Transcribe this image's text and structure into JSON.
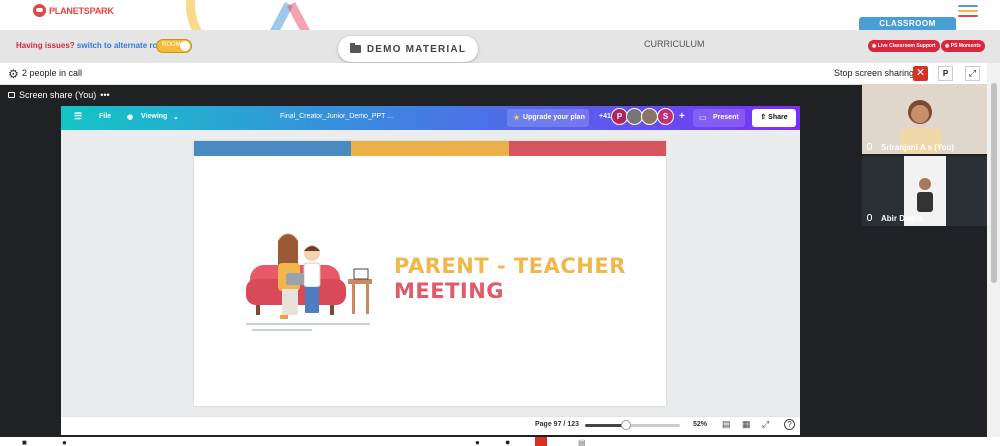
{
  "app": {
    "brand": "PLANETSPARK",
    "issue_text": "Having issues?",
    "issue_link": "switch to alternate room",
    "toggle_label": "ROOM",
    "demo_material": "DEMO MATERIAL",
    "curriculum": "CURRICULUM",
    "classroom": "CLASSROOM",
    "support_button": "Live Classroom Support",
    "moments_button": "PS Moments"
  },
  "call": {
    "people_label": "2 people in call",
    "stop_sharing": "Stop screen sharing",
    "close_icon": "close-icon",
    "presenter_initial": "P",
    "screen_share_label": "Screen share (You)",
    "more_label": "•••"
  },
  "canva": {
    "file": "File",
    "viewing": "Viewing",
    "doc_title": "Final_Creator_Junior_Demo_PPT ...",
    "upgrade": "Upgrade your plan",
    "collab_count": "+41",
    "avatar_p": "P",
    "avatar_s": "S",
    "plus": "+",
    "present": "Present",
    "share": "Share",
    "page_indicator": "Page 97 / 123",
    "zoom": "52%",
    "zoom_fraction": 0.42,
    "help": "?"
  },
  "slide": {
    "title_line1": "PARENT - TEACHER",
    "title_line2": "MEETING",
    "stripe_colors": [
      "#4a8ac3",
      "#edb14b",
      "#d6545e"
    ]
  },
  "participants": [
    {
      "name": "Sriranjani A s (You)"
    },
    {
      "name": "Abir Dogra"
    }
  ],
  "colors": {
    "accent_red": "#d7263d",
    "classroom_blue": "#4a9ed6",
    "toggle_yellow": "#f2bb38"
  }
}
